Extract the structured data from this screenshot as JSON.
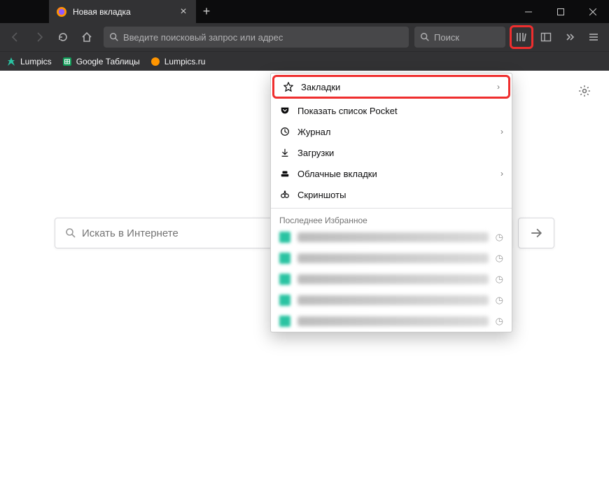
{
  "window": {
    "tab_title": "Новая вкладка"
  },
  "nav": {
    "url_placeholder": "Введите поисковый запрос или адрес",
    "search_placeholder": "Поиск"
  },
  "bookmarks_bar": {
    "items": [
      {
        "label": "Lumpics"
      },
      {
        "label": "Google Таблицы"
      },
      {
        "label": "Lumpics.ru"
      }
    ]
  },
  "content": {
    "search_placeholder": "Искать в Интернете"
  },
  "library_menu": {
    "items": [
      {
        "label": "Закладки",
        "has_submenu": true
      },
      {
        "label": "Показать список Pocket",
        "has_submenu": false
      },
      {
        "label": "Журнал",
        "has_submenu": true
      },
      {
        "label": "Загрузки",
        "has_submenu": false
      },
      {
        "label": "Облачные вкладки",
        "has_submenu": true
      },
      {
        "label": "Скриншоты",
        "has_submenu": false
      }
    ],
    "recent_header": "Последнее Избранное",
    "recent_count": 5
  }
}
